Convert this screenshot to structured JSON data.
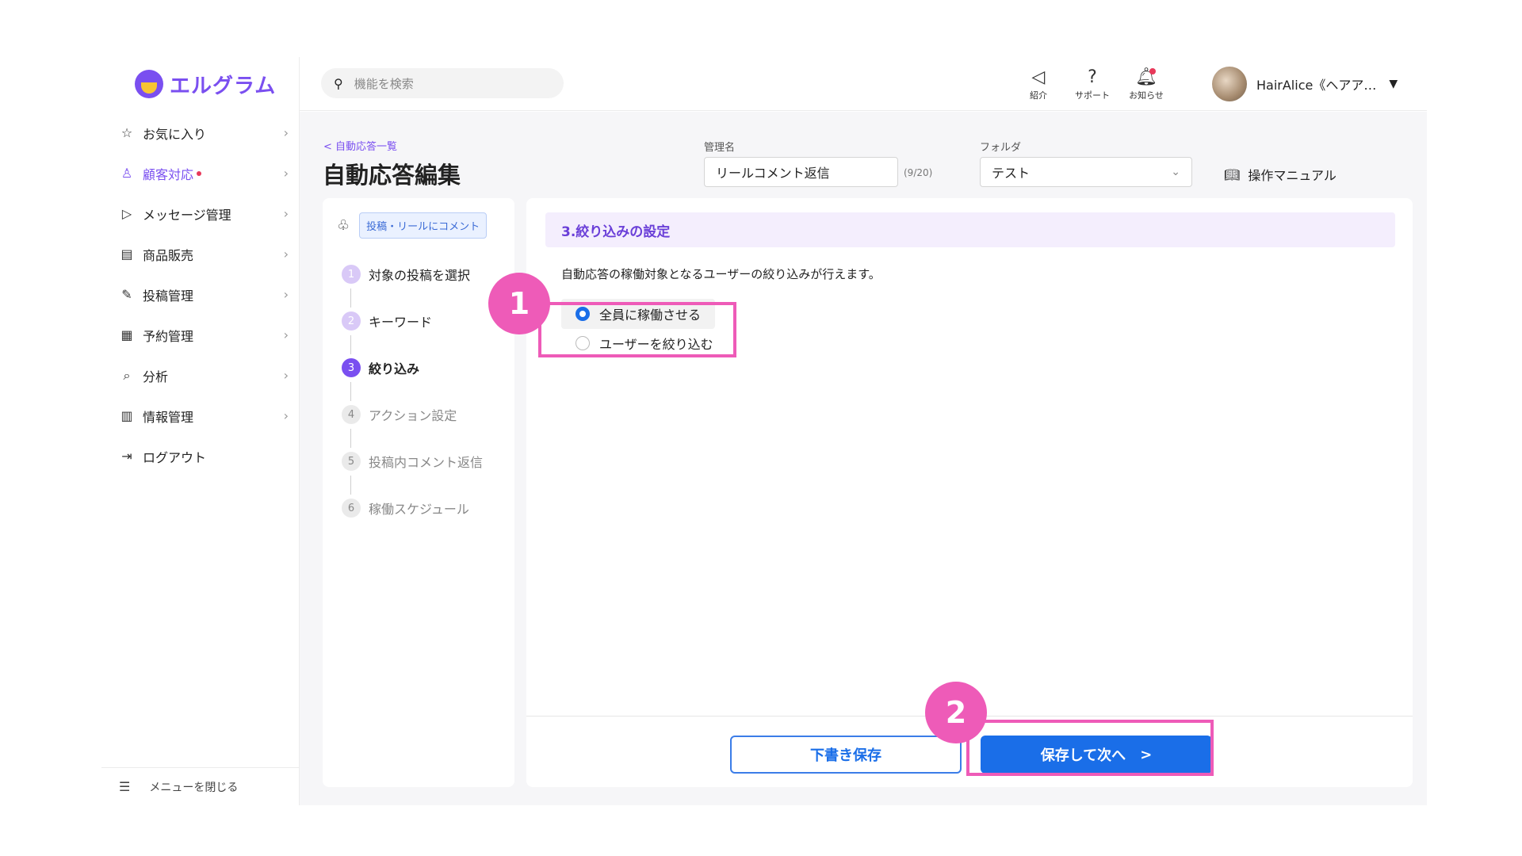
{
  "logo": {
    "text": "エルグラム"
  },
  "sidebar": {
    "items": [
      {
        "label": "お気に入り",
        "icon": "star-icon",
        "glyph": "☆"
      },
      {
        "label": "顧客対応",
        "icon": "person-icon",
        "glyph": "♙"
      },
      {
        "label": "メッセージ管理",
        "icon": "send-icon",
        "glyph": "▷"
      },
      {
        "label": "商品販売",
        "icon": "store-icon",
        "glyph": "▤"
      },
      {
        "label": "投稿管理",
        "icon": "edit-icon",
        "glyph": "✎"
      },
      {
        "label": "予約管理",
        "icon": "calendar-icon",
        "glyph": "▦"
      },
      {
        "label": "分析",
        "icon": "analysis-icon",
        "glyph": "⌕"
      },
      {
        "label": "情報管理",
        "icon": "chart-icon",
        "glyph": "▥"
      },
      {
        "label": "ログアウト",
        "icon": "logout-icon",
        "glyph": "⇥"
      }
    ],
    "collapse_label": "メニューを閉じる"
  },
  "header": {
    "search_placeholder": "機能を検索",
    "icons": [
      {
        "label": "紹介",
        "glyph": "◁"
      },
      {
        "label": "サポート",
        "glyph": "?"
      },
      {
        "label": "お知らせ",
        "glyph": "♫"
      }
    ],
    "user_name": "HairAlice《ヘアア…"
  },
  "page": {
    "breadcrumb": "< 自動応答一覧",
    "title": "自動応答編集",
    "name_label": "管理名",
    "name_value": "リールコメント返信",
    "name_counter": "(9/20)",
    "folder_label": "フォルダ",
    "folder_value": "テスト",
    "manual_label": "操作マニュアル"
  },
  "steps_panel": {
    "trigger_badge": "投稿・リールにコメント",
    "steps": [
      {
        "num": "1",
        "label": "対象の投稿を選択",
        "state": "done"
      },
      {
        "num": "2",
        "label": "キーワード",
        "state": "done"
      },
      {
        "num": "3",
        "label": "絞り込み",
        "state": "current"
      },
      {
        "num": "4",
        "label": "アクション設定",
        "state": "todo"
      },
      {
        "num": "5",
        "label": "投稿内コメント返信",
        "state": "todo"
      },
      {
        "num": "6",
        "label": "稼働スケジュール",
        "state": "todo"
      }
    ]
  },
  "content": {
    "section_title": "3.絞り込みの設定",
    "description": "自動応答の稼働対象となるユーザーの絞り込みが行えます。",
    "options": [
      {
        "label": "全員に稼働させる",
        "selected": true
      },
      {
        "label": "ユーザーを絞り込む",
        "selected": false
      }
    ],
    "draft_button": "下書き保存",
    "next_button": "保存して次へ",
    "next_arrow": ">"
  },
  "annotations": {
    "badge1": "1",
    "badge2": "2"
  },
  "colors": {
    "brand": "#7a4ff0",
    "primary": "#1a6ee8",
    "highlight": "#ee5bb8",
    "alert": "#e8395a"
  }
}
